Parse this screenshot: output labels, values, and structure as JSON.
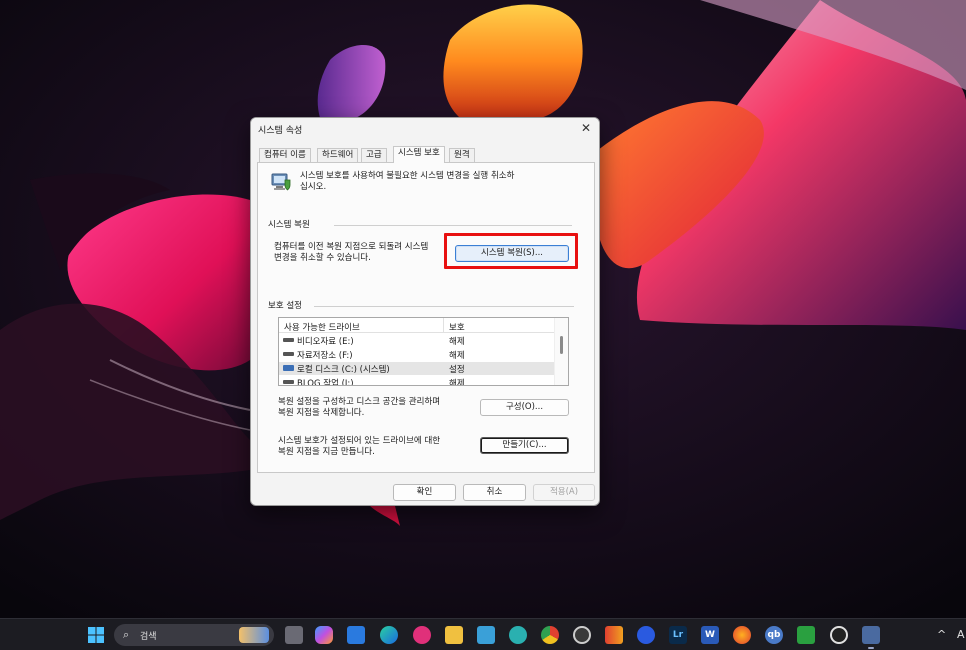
{
  "dialog": {
    "title": "시스템 속성",
    "close_glyph": "✕",
    "tabs": [
      {
        "label": "컴퓨터 이름"
      },
      {
        "label": "하드웨어"
      },
      {
        "label": "고급"
      },
      {
        "label": "시스템 보호",
        "active": true
      },
      {
        "label": "원격"
      }
    ],
    "intro_line1": "시스템 보호를 사용하여 불필요한 시스템 변경을 실행 취소하",
    "intro_line2": "십시오.",
    "intro_icon": "system-protection-icon",
    "restore": {
      "group_label": "시스템 복원",
      "desc_line1": "컴퓨터를 이전 복원 지점으로 되돌려 시스템",
      "desc_line2": "변경을 취소할 수 있습니다.",
      "button_label": "시스템 복원(S)..."
    },
    "protection": {
      "group_label": "보호 설정",
      "columns": [
        "사용 가능한 드라이브",
        "보호"
      ],
      "drives": [
        {
          "name": "비디오자료 (E:)",
          "status": "해제",
          "icon": "drive-icon"
        },
        {
          "name": "자료저장소 (F:)",
          "status": "해제",
          "icon": "drive-icon"
        },
        {
          "name": "로컬 디스크 (C:) (시스템)",
          "status": "설정",
          "icon": "system-drive-icon",
          "selected": true
        },
        {
          "name": "BLOG 작업 (I:)",
          "status": "해제",
          "icon": "drive-icon"
        }
      ],
      "configure_line1": "복원 설정을 구성하고 디스크 공간을 관리하며",
      "configure_line2": "복원 지점을 삭제합니다.",
      "configure_button": "구성(O)...",
      "create_line1": "시스템 보호가 설정되어 있는 드라이브에 대한",
      "create_line2": "복원 지점을 지금 만듭니다.",
      "create_button": "만들기(C)..."
    },
    "footer": {
      "ok": "확인",
      "cancel": "취소",
      "apply": "적용(A)"
    }
  },
  "taskbar": {
    "search_placeholder": "검색",
    "apps": [
      "start-icon",
      "task-view-icon",
      "copilot-icon",
      "store-icon",
      "edge-icon",
      "photo-app-icon",
      "file-explorer-icon",
      "notepad-icon",
      "app-icon",
      "chrome-icon",
      "app-icon",
      "app-icon",
      "todo-icon",
      "lightroom-icon",
      "word-icon",
      "firefox-icon",
      "qbittorrent-icon",
      "evernote-icon",
      "app-icon",
      "system-properties-icon"
    ],
    "tray_chevron": "^",
    "tray_text": "A"
  },
  "colors": {
    "highlight_border": "#e81010",
    "primary_button_border": "#3b7fd4"
  }
}
